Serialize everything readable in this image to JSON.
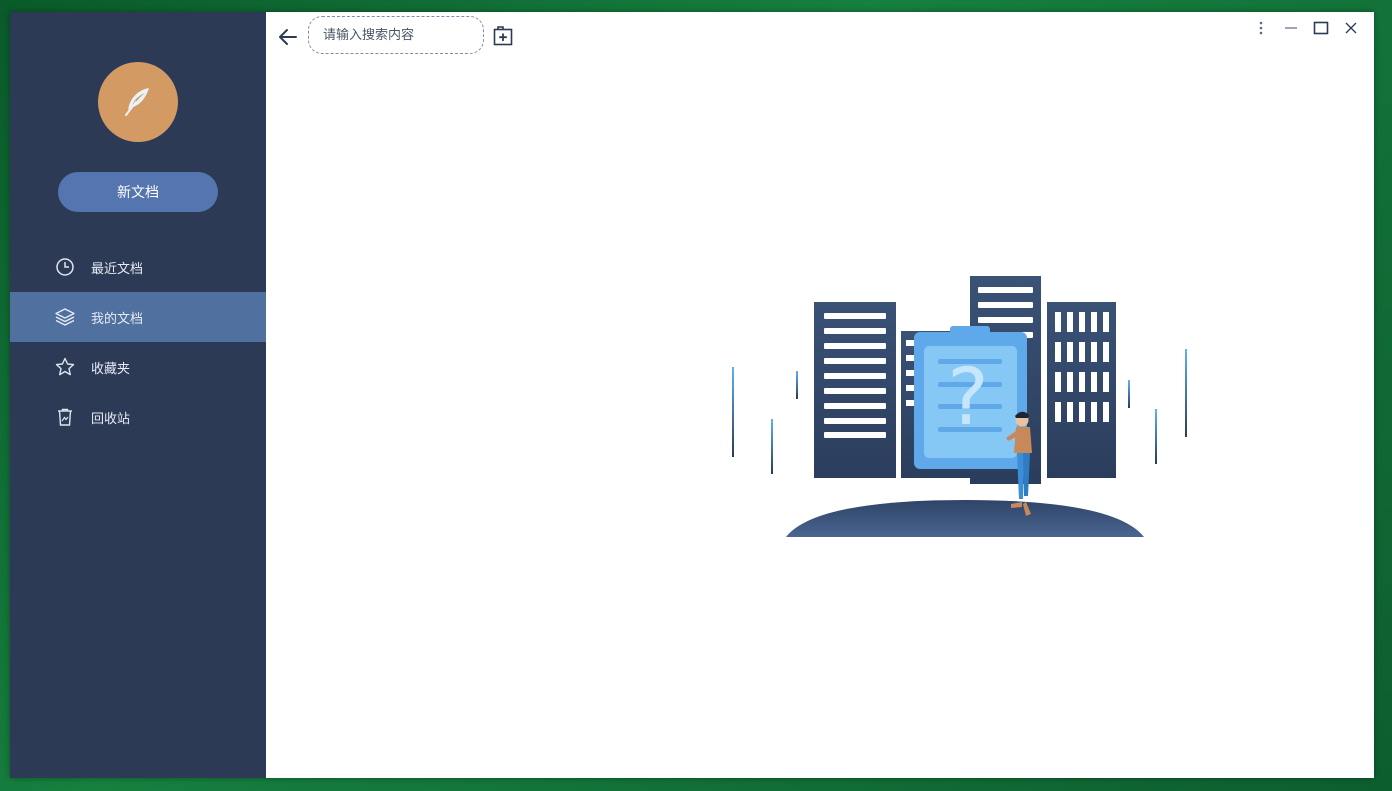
{
  "theme": {
    "sidebar_bg": "#2c3a55",
    "active_item_bg": "#50709f",
    "new_doc_button_bg": "#5575b0",
    "avatar_bg": "#d39b63",
    "accent_blue": "#5fb3f0"
  },
  "sidebar": {
    "avatar_icon": "feather-icon",
    "new_doc_label": "新文档",
    "items": [
      {
        "label": "最近文档",
        "icon": "clock-icon",
        "active": false
      },
      {
        "label": "我的文档",
        "icon": "layers-icon",
        "active": true
      },
      {
        "label": "收藏夹",
        "icon": "star-icon",
        "active": false
      },
      {
        "label": "回收站",
        "icon": "trash-icon",
        "active": false
      }
    ]
  },
  "toolbar": {
    "back_icon": "arrow-left-icon",
    "search_placeholder": "请输入搜索内容",
    "search_value": "",
    "add_icon": "add-folder-icon"
  },
  "window_controls": [
    "more-icon",
    "minimize-icon",
    "maximize-icon",
    "close-icon"
  ],
  "main": {
    "empty_state_illustration": "empty-documents-illustration"
  }
}
